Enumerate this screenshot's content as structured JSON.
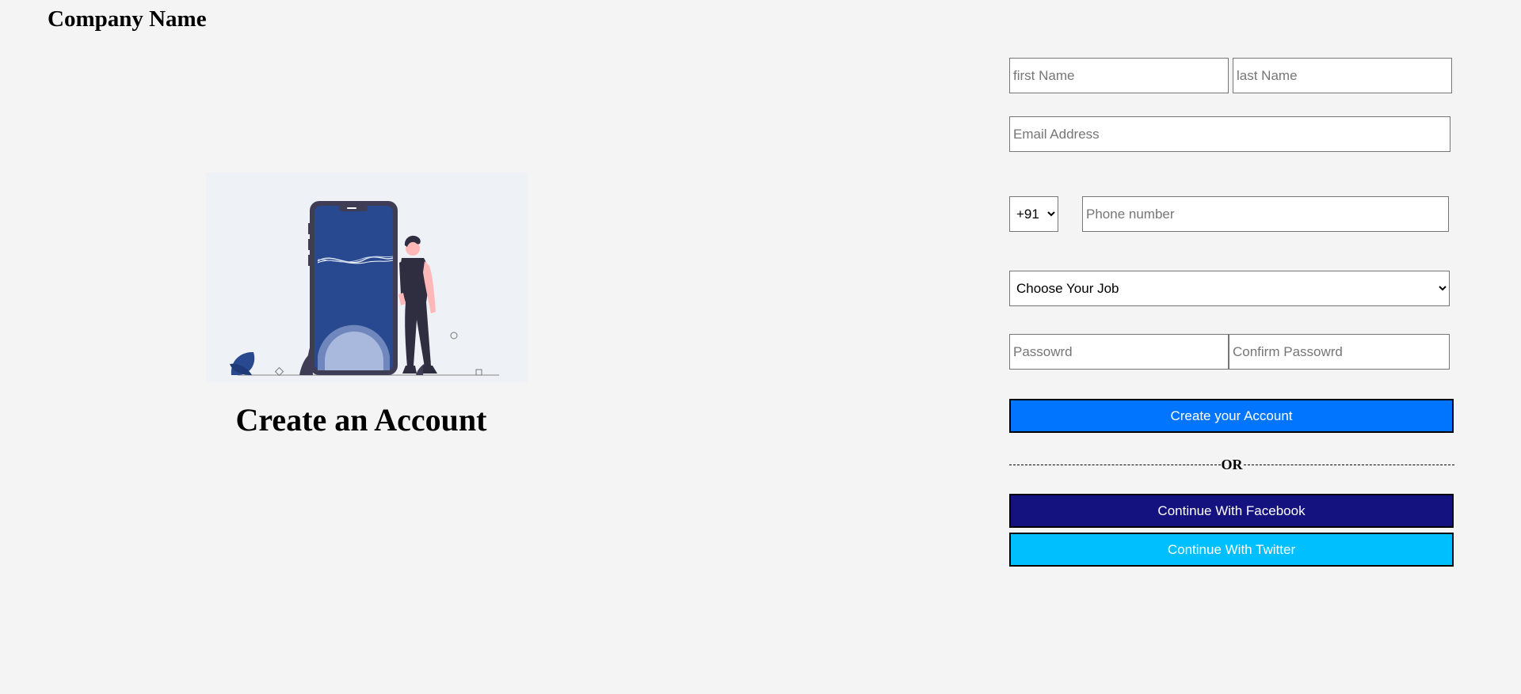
{
  "header": {
    "company_name": "Company Name"
  },
  "hero": {
    "title": "Create an Account"
  },
  "form": {
    "first_name": {
      "placeholder": "first Name",
      "value": ""
    },
    "last_name": {
      "placeholder": "last Name",
      "value": ""
    },
    "email": {
      "placeholder": "Email Address",
      "value": ""
    },
    "country_code": {
      "selected": "+91"
    },
    "phone": {
      "placeholder": "Phone number",
      "value": ""
    },
    "job": {
      "selected": "Choose Your Job"
    },
    "password": {
      "placeholder": "Passowrd",
      "value": ""
    },
    "confirm_password": {
      "placeholder": "Confirm Passowrd",
      "value": ""
    },
    "create_label": "Create your Account",
    "or_label": "OR",
    "facebook_label": "Continue With Facebook",
    "twitter_label": "Continue With Twitter"
  },
  "colors": {
    "background": "#f4f4f4",
    "create_button": "#0275ff",
    "facebook_button": "#13127e",
    "twitter_button": "#00bfff",
    "illustration_phone_screen": "#28498f"
  },
  "icons": {
    "illustration": "person-leaning-on-smartphone-illustration",
    "select_arrow": "chevron-down-icon"
  }
}
